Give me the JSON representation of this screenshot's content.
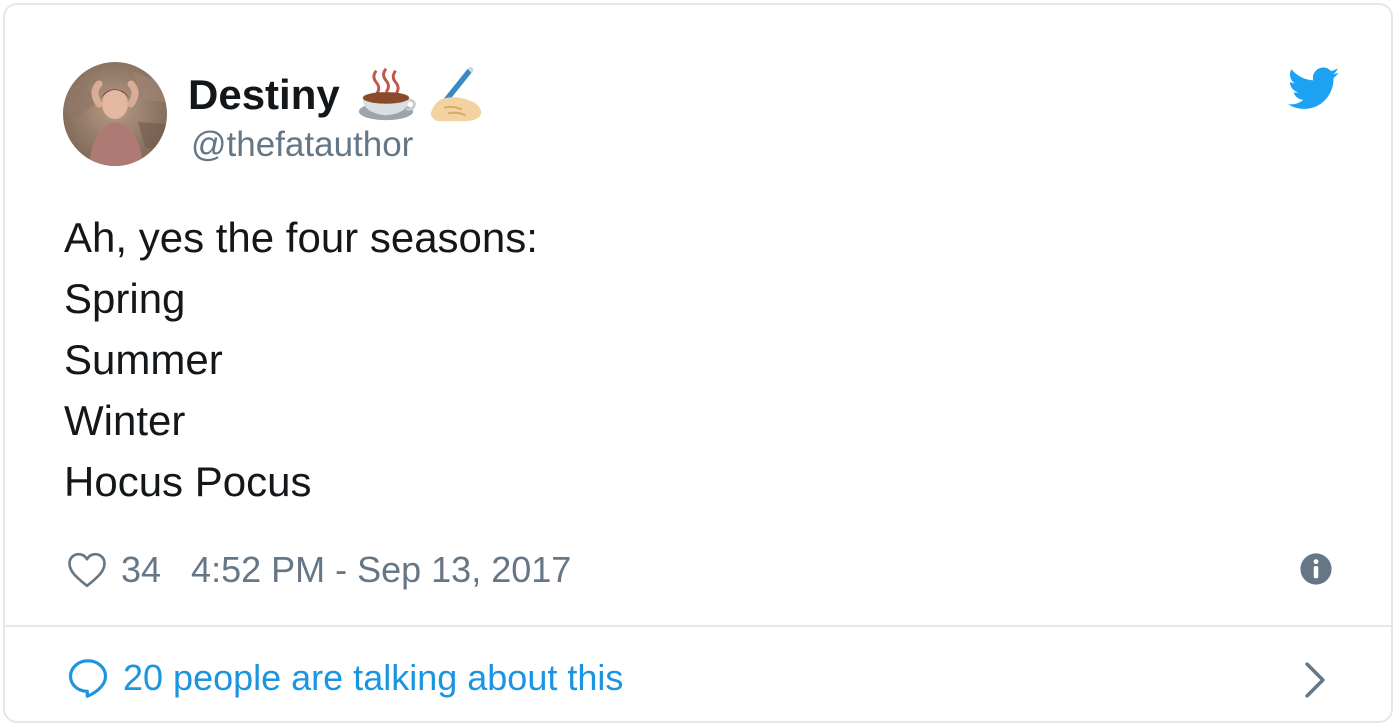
{
  "tweet": {
    "display_name": "Destiny",
    "handle": "@thefatauthor",
    "name_emojis": [
      "hot-beverage-icon",
      "writing-hand-icon"
    ],
    "avatar": "profile-photo-avatar",
    "text_lines": [
      "Ah, yes the four seasons:",
      "Spring",
      "Summer",
      "Winter",
      "Hocus Pocus"
    ],
    "like_count": "34",
    "timestamp": "4:52 PM - Sep 13, 2017",
    "conversation_text": "20 people are talking about this"
  },
  "icons": {
    "brand": "twitter-bird-icon",
    "like": "heart-icon",
    "info": "info-icon",
    "reply": "speech-bubble-icon",
    "more": "chevron-right-icon"
  },
  "colors": {
    "twitter_blue": "#1da1f2",
    "link_blue": "#1b95e0",
    "text": "#14171a",
    "secondary_text": "#657786",
    "border": "#e1e8ed"
  }
}
